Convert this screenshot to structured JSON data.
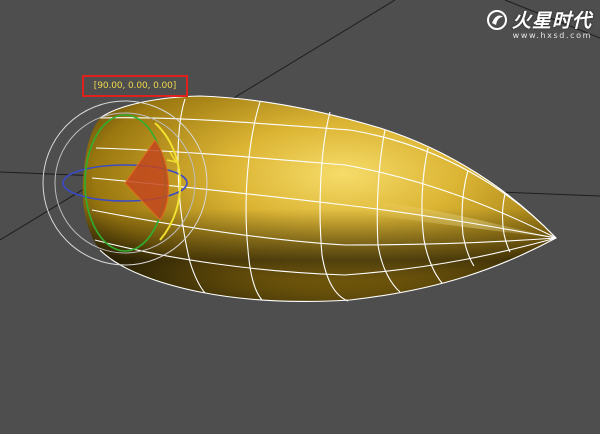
{
  "viewport": {
    "background": "#4e4e4e",
    "grid_line_color": "#1e1e1e"
  },
  "rotation_readout": {
    "text": "[90.00, 0.00, 0.00]",
    "text_color": "#f1d94a",
    "highlight_box_color": "#e0201c"
  },
  "model": {
    "object": "bullet-shaped-mesh",
    "material_color": "#d9b12f",
    "wireframe_color": "#ffffff",
    "selected": true
  },
  "rotate_gizmo": {
    "outer_ring_color": "#d8d8d8",
    "x_axis_color": "#3a4bc8",
    "y_axis_color": "#2fae2f",
    "z_axis_color": "#f0e030",
    "pie_indicator_color": "#c2461e"
  },
  "watermark": {
    "brand_cn": "火星时代",
    "url": "www.hxsd.com"
  }
}
